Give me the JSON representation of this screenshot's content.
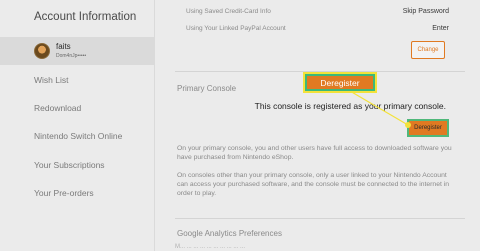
{
  "sidebar": {
    "title": "Account Information",
    "user": {
      "name": "faits",
      "subtitle": "Dom4nJp•••••"
    },
    "items": [
      {
        "label": "Wish List"
      },
      {
        "label": "Redownload"
      },
      {
        "label": "Nintendo Switch Online"
      },
      {
        "label": "Your Subscriptions"
      },
      {
        "label": "Your Pre-orders"
      }
    ]
  },
  "main": {
    "rows": [
      {
        "label": "Using Saved Credit-Card Info",
        "value": "Skip Password"
      },
      {
        "label": "Using Your Linked PayPal Account",
        "value": "Enter"
      }
    ],
    "change_label": "Change",
    "primary_console": {
      "title": "Primary Console",
      "message": "This console is registered as your primary console.",
      "deregister_label": "Deregister",
      "para1": "On your primary console, you and other users have full access to downloaded software you have purchased from Nintendo eShop.",
      "para2": "On consoles other than your primary console, only a user linked to your Nintendo Account can access your purchased software, and the console must be connected to the internet in order to play."
    },
    "analytics_title": "Google Analytics Preferences",
    "bottom_fragment": "M... ... ... ... ... ... ... ... ... ..."
  },
  "annotation": {
    "label": "Deregister",
    "colors": {
      "fill": "#e07a22",
      "border": "#3cb87a",
      "outline": "#f3e23a",
      "line": "#f3e23a"
    }
  }
}
